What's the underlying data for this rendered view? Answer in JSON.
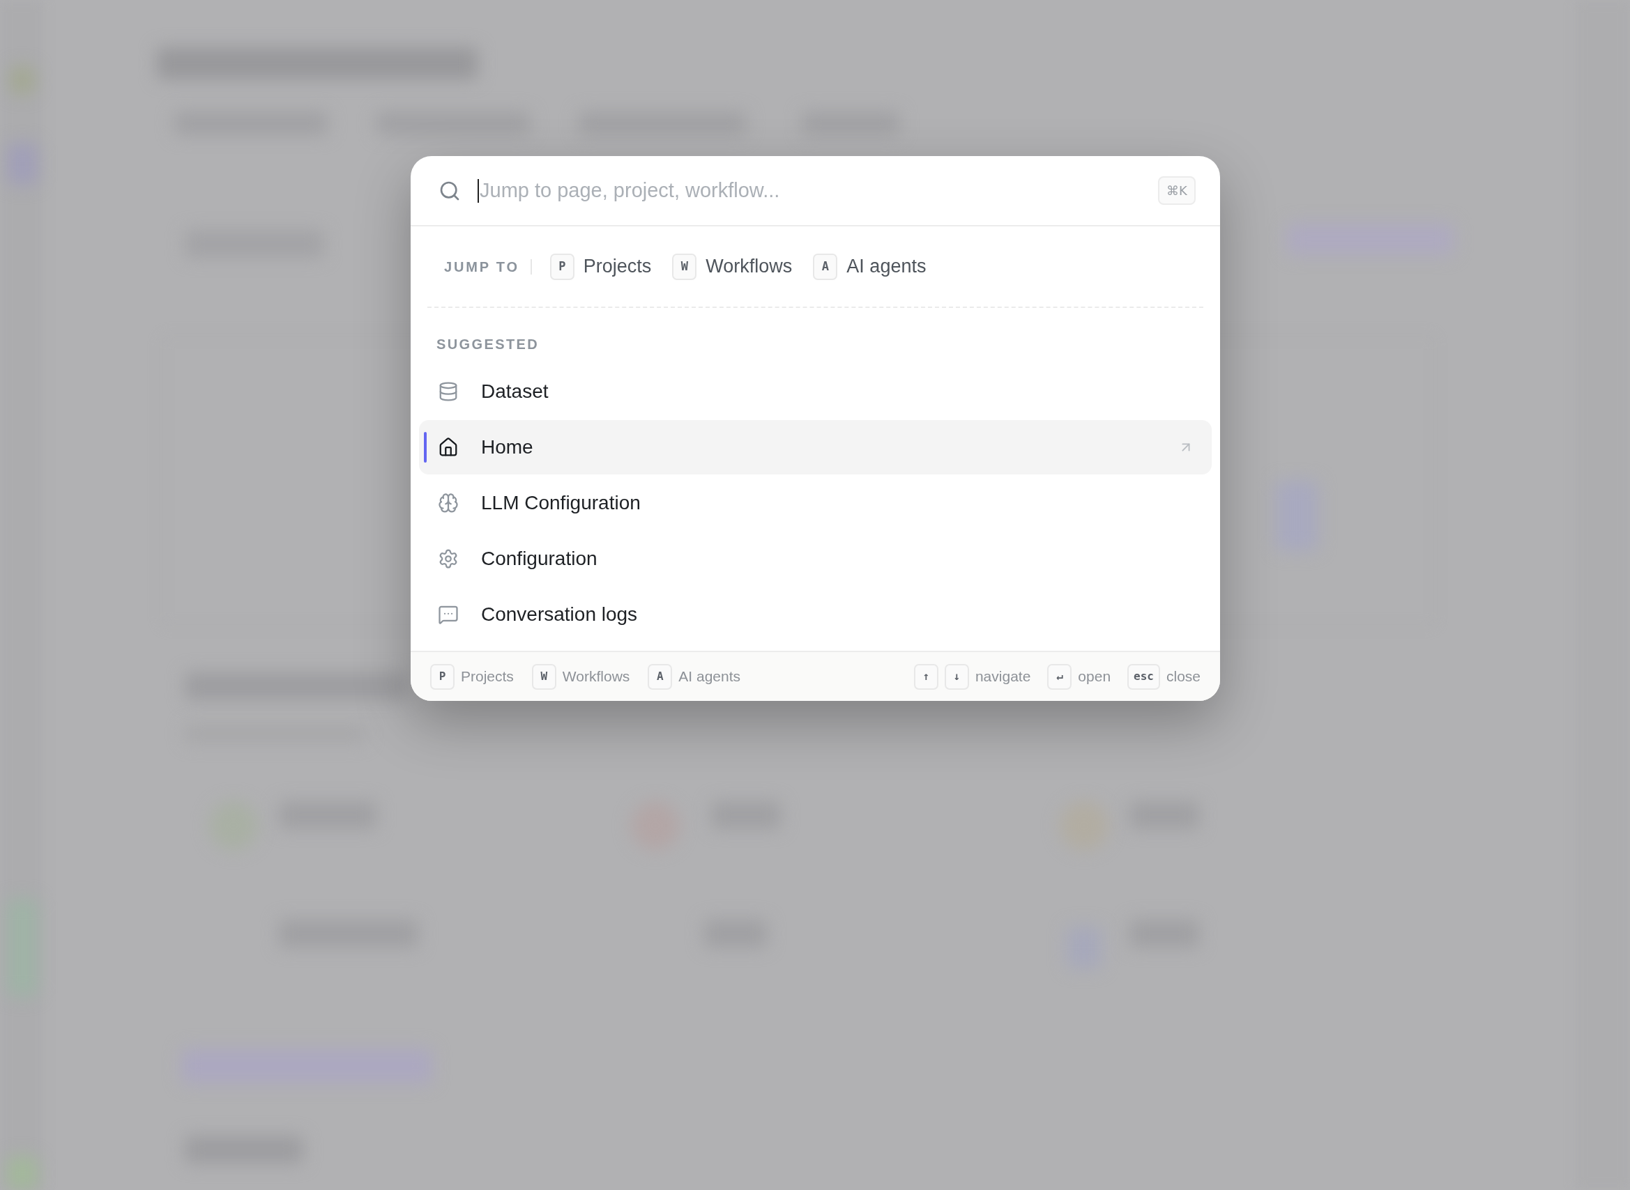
{
  "search": {
    "placeholder": "Jump to page, project, workflow...",
    "shortcut": "⌘K"
  },
  "jump_to": {
    "label": "JUMP TO",
    "items": [
      {
        "key": "P",
        "label": "Projects"
      },
      {
        "key": "W",
        "label": "Workflows"
      },
      {
        "key": "A",
        "label": "AI agents"
      }
    ]
  },
  "suggested": {
    "heading": "SUGGESTED",
    "items": [
      {
        "kind": "dataset",
        "label": "Dataset",
        "selected": false
      },
      {
        "kind": "home",
        "label": "Home",
        "selected": true
      },
      {
        "kind": "model",
        "label": "LLM Configuration",
        "selected": false
      },
      {
        "kind": "settings",
        "label": "Configuration",
        "selected": false
      },
      {
        "kind": "logs",
        "label": "Conversation logs",
        "selected": false
      }
    ]
  },
  "footer": {
    "left": [
      {
        "keys": [
          "P"
        ],
        "label": "Projects"
      },
      {
        "keys": [
          "W"
        ],
        "label": "Workflows"
      },
      {
        "keys": [
          "A"
        ],
        "label": "AI agents"
      }
    ],
    "right": [
      {
        "keys": [
          "↑",
          "↓"
        ],
        "label": "navigate"
      },
      {
        "keys": [
          "↵"
        ],
        "label": "open"
      },
      {
        "keys": [
          "esc"
        ],
        "label": "close"
      }
    ]
  }
}
